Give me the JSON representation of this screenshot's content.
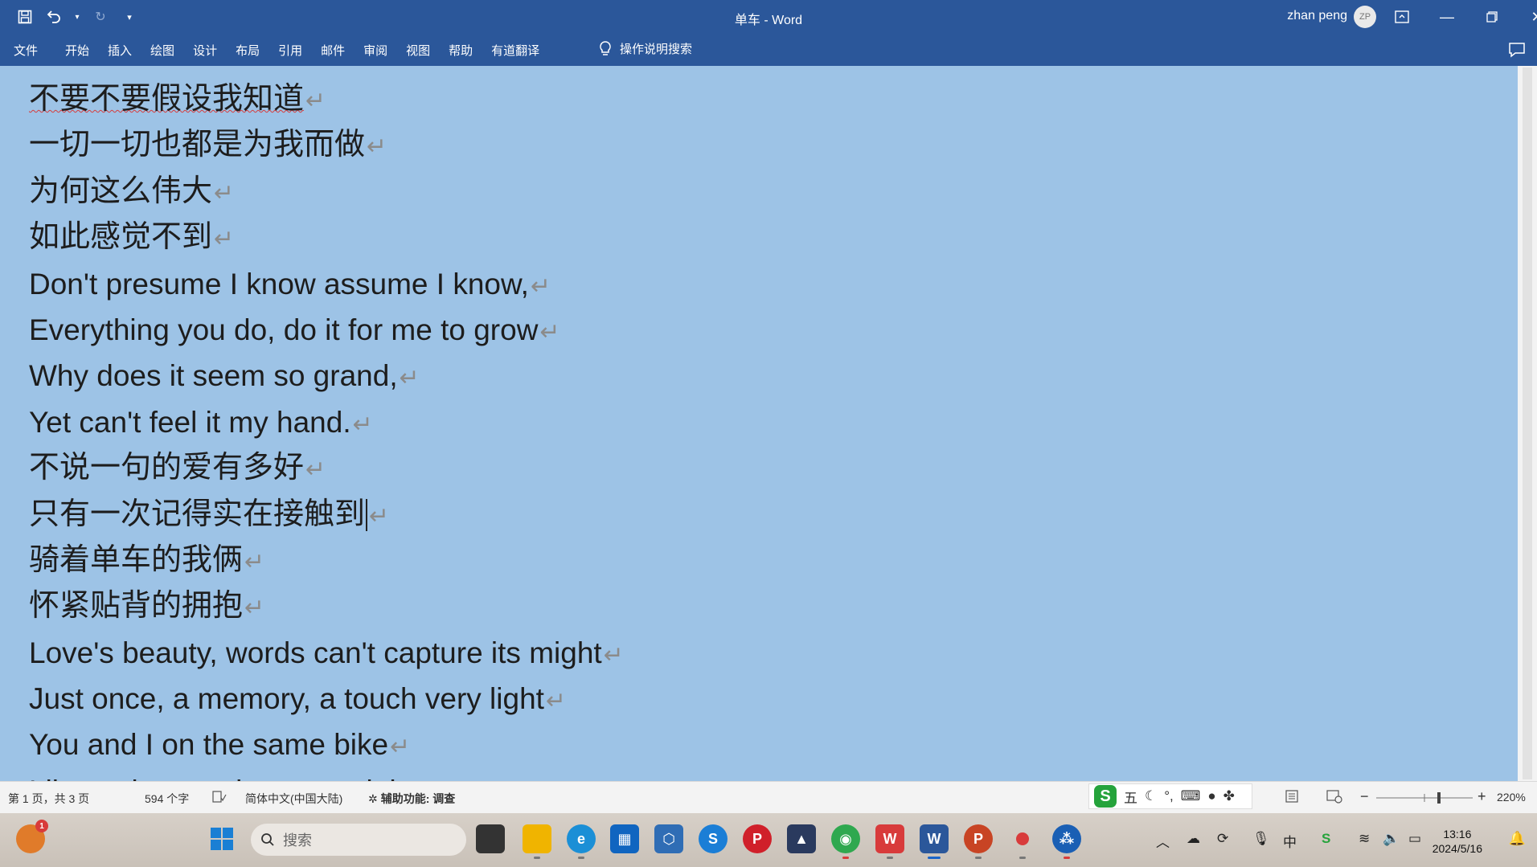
{
  "titlebar": {
    "title": "单车  -  Word",
    "user_name": "zhan peng",
    "avatar_initials": "ZP"
  },
  "ribbon": {
    "tabs": [
      "文件",
      "开始",
      "插入",
      "绘图",
      "设计",
      "布局",
      "引用",
      "邮件",
      "审阅",
      "视图",
      "帮助",
      "有道翻译"
    ],
    "tell_me": "操作说明搜索"
  },
  "document": {
    "lines": [
      "不要不要假设我知道",
      "一切一切也都是为我而做",
      "为何这么伟大",
      "如此感觉不到",
      "Don't presume I know assume I know,",
      "Everything you do, do it for me to grow",
      "Why does it seem so grand,",
      "Yet can't feel it my hand.",
      "不说一句的爱有多好",
      "只有一次记得实在接触到",
      "骑着单车的我俩",
      "怀紧贴背的拥抱",
      "Love's beauty, words can't capture its might",
      "Just once, a memory, a touch very light",
      "You and I on the same bike",
      "Like a close embrace so tight"
    ],
    "paragraph_mark": "↵"
  },
  "statusbar": {
    "page": "第 1 页，共 3 页",
    "word_count": "594 个字",
    "language": "简体中文(中国大陆)",
    "accessibility": "辅助功能: 调查",
    "zoom": "220%",
    "ime_mode": "五"
  },
  "taskbar": {
    "search_placeholder": "搜索",
    "notification_count": "1",
    "time": "13:16",
    "date": "2024/5/16"
  },
  "colors": {
    "accent": "#2b579a",
    "document_selection": "#9dc3e6",
    "wps_red": "#d83b3b"
  }
}
